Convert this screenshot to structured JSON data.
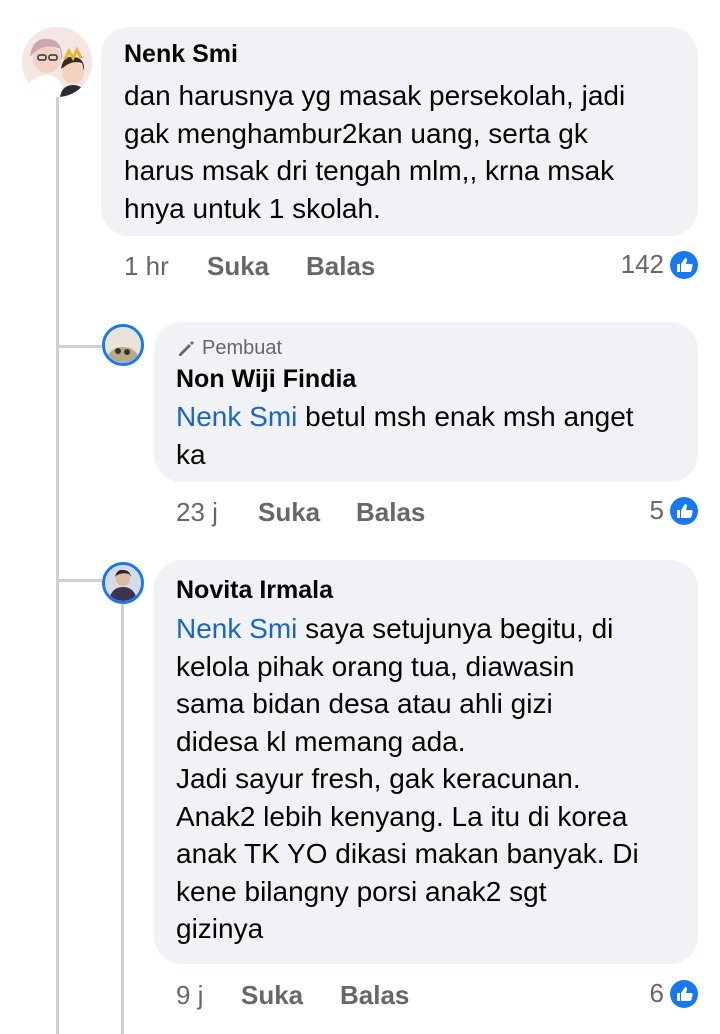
{
  "comments": [
    {
      "author": "Nenk Smi",
      "text": "dan harusnya yg masak persekolah, jadi\ngak menghambur2kan uang, serta gk\nharus msak dri tengah mlm,, krna msak\nhnya untuk 1 skolah.",
      "time": "1 hr",
      "like_label": "Suka",
      "reply_label": "Balas",
      "reaction_count": "142",
      "reaction_icon": "like-icon"
    },
    {
      "badge": "Pembuat",
      "badge_icon": "pencil-icon",
      "author": "Non Wiji Findia",
      "mention": "Nenk Smi",
      "text": " betul msh enak msh anget\nka",
      "time": "23 j",
      "like_label": "Suka",
      "reply_label": "Balas",
      "reaction_count": "5",
      "reaction_icon": "like-icon"
    },
    {
      "author": "Novita Irmala",
      "mention": "Nenk Smi",
      "text": " saya setujunya begitu, di\nkelola pihak orang tua, diawasin\nsama bidan desa atau ahli gizi\ndidesa kl memang ada.\nJadi sayur fresh, gak keracunan.\nAnak2 lebih kenyang. La itu di korea\nanak TK YO  dikasi makan banyak. Di\nkene bilangny porsi anak2 sgt\ngizinya",
      "time": "9 j",
      "like_label": "Suka",
      "reply_label": "Balas",
      "reaction_count": "6",
      "reaction_icon": "like-icon"
    }
  ],
  "colors": {
    "bubble": "#f0f2f5",
    "mention": "#1b64c8",
    "meta": "#65676b",
    "like_blue": "#1877f2",
    "thread_line": "#ced0d4"
  }
}
